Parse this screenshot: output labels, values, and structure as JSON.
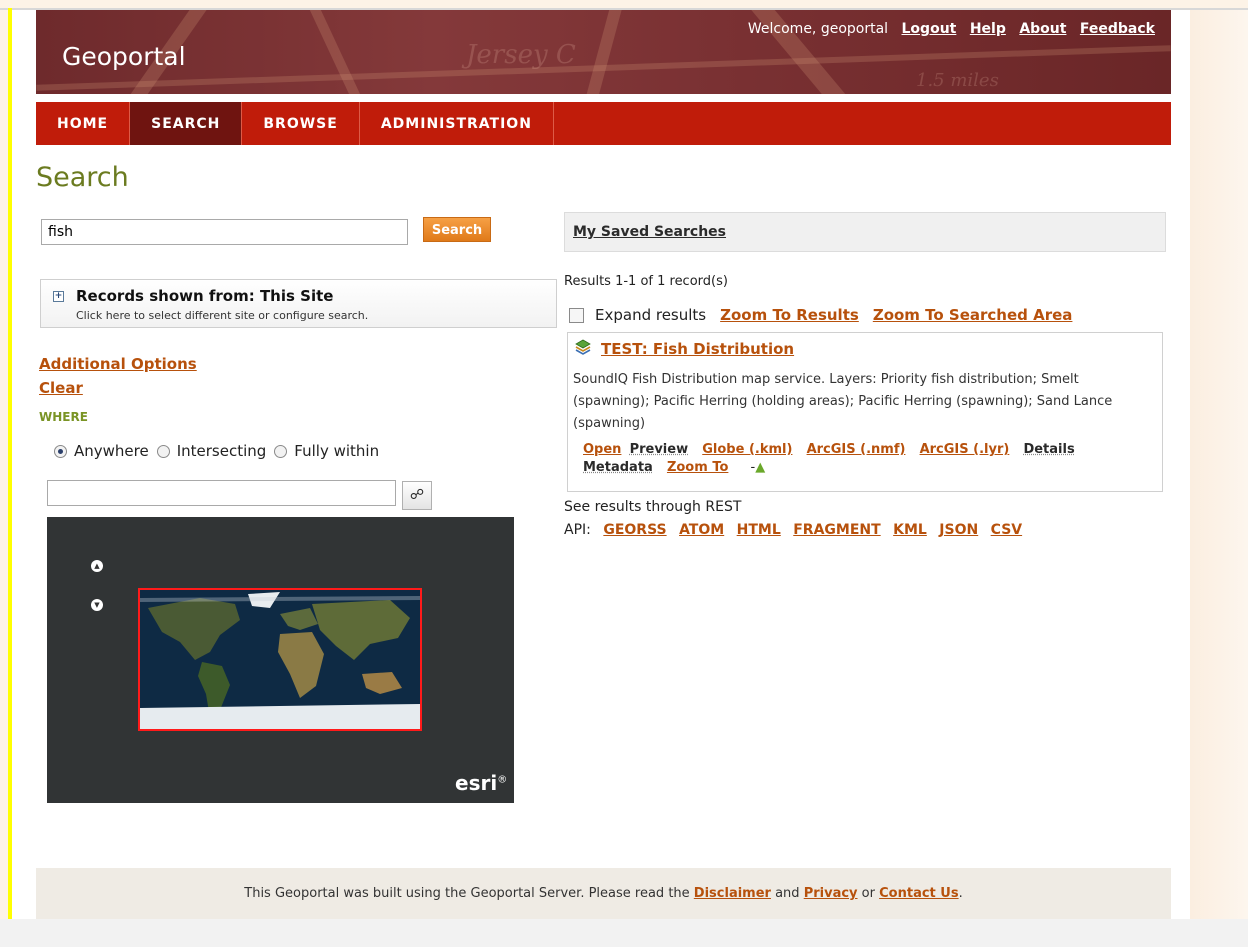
{
  "header": {
    "site_title": "Geoportal",
    "welcome": "Welcome, geoportal",
    "links": [
      "Logout",
      "Help",
      "About",
      "Feedback"
    ]
  },
  "nav": {
    "tabs": [
      {
        "label": "HOME",
        "active": false
      },
      {
        "label": "SEARCH",
        "active": true
      },
      {
        "label": "BROWSE",
        "active": false
      },
      {
        "label": "ADMINISTRATION",
        "active": false
      }
    ]
  },
  "page_title": "Search",
  "search": {
    "query": "fish",
    "button_label": "Search"
  },
  "records_box": {
    "title": "Records shown from: This Site",
    "subtitle": "Click here to select different site or configure search."
  },
  "options": {
    "additional_options": "Additional Options",
    "clear": "Clear",
    "where_label": "WHERE",
    "radios": [
      {
        "label": "Anywhere",
        "selected": true
      },
      {
        "label": "Intersecting",
        "selected": false
      },
      {
        "label": "Fully within",
        "selected": false
      }
    ],
    "where_value": ""
  },
  "map": {
    "logo": "esri",
    "logo_mark": "®"
  },
  "saved_searches": {
    "label": "My Saved Searches"
  },
  "results": {
    "count_text": "Results 1-1 of 1 record(s)",
    "expand_label": "Expand results",
    "expand_checked": false,
    "zoom_to_results": "Zoom To Results",
    "zoom_to_searched_area": "Zoom To Searched Area",
    "items": [
      {
        "title": "TEST: Fish Distribution",
        "description": "SoundIQ Fish Distribution map service. Layers: Priority fish distribution; Smelt (spawning); Pacific Herring (holding areas); Pacific Herring (spawning); Sand Lance (spawning)",
        "actions": {
          "open": "Open",
          "preview": "Preview",
          "globe": "Globe (.kml)",
          "arcgis_nmf": "ArcGIS (.nmf)",
          "arcgis_lyr": "ArcGIS (.lyr)",
          "details": "Details",
          "metadata": "Metadata",
          "zoom_to": "Zoom To",
          "dash": "-"
        }
      }
    ],
    "rest_text": "See results through REST",
    "api_label": "API:",
    "api_links": [
      "GEORSS",
      "ATOM",
      "HTML",
      "FRAGMENT",
      "KML",
      "JSON",
      "CSV"
    ]
  },
  "footer": {
    "prefix": "This Geoportal was built using the Geoportal Server. Please read the",
    "disclaimer": "Disclaimer",
    "and": "and",
    "privacy": "Privacy",
    "or": "or",
    "contact": "Contact Us",
    "suffix": "."
  },
  "colors": {
    "nav_red": "#c01c0a",
    "nav_active": "#6f1410",
    "link_orange": "#b7510c",
    "title_olive": "#6b7b20",
    "search_button": "#f08c28"
  }
}
